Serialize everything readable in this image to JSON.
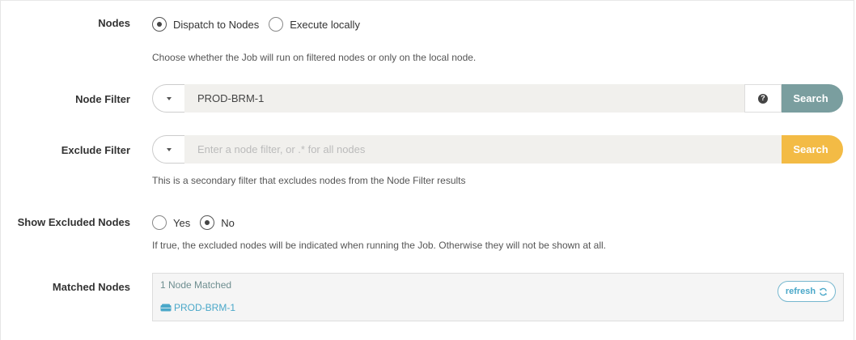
{
  "nodes": {
    "label": "Nodes",
    "options": [
      {
        "label": "Dispatch to Nodes",
        "checked": true
      },
      {
        "label": "Execute locally",
        "checked": false
      }
    ],
    "help": "Choose whether the Job will run on filtered nodes or only on the local node."
  },
  "node_filter": {
    "label": "Node Filter",
    "value": "PROD-BRM-1",
    "help_icon": "question-circle-icon",
    "search_label": "Search",
    "search_color": "#7a9e9f"
  },
  "exclude_filter": {
    "label": "Exclude Filter",
    "placeholder": "Enter a node filter, or .* for all nodes",
    "search_label": "Search",
    "search_color": "#f3bb45",
    "help": "This is a secondary filter that excludes nodes from the Node Filter results"
  },
  "show_excluded": {
    "label": "Show Excluded Nodes",
    "options": [
      {
        "label": "Yes",
        "checked": false
      },
      {
        "label": "No",
        "checked": true
      }
    ],
    "help": "If true, the excluded nodes will be indicated when running the Job. Otherwise they will not be shown at all."
  },
  "matched": {
    "label": "Matched Nodes",
    "count_text": "1 Node Matched",
    "nodes": [
      "PROD-BRM-1"
    ],
    "refresh_label": "refresh",
    "refresh_icon": "refresh-icon",
    "node_icon": "server-icon"
  }
}
